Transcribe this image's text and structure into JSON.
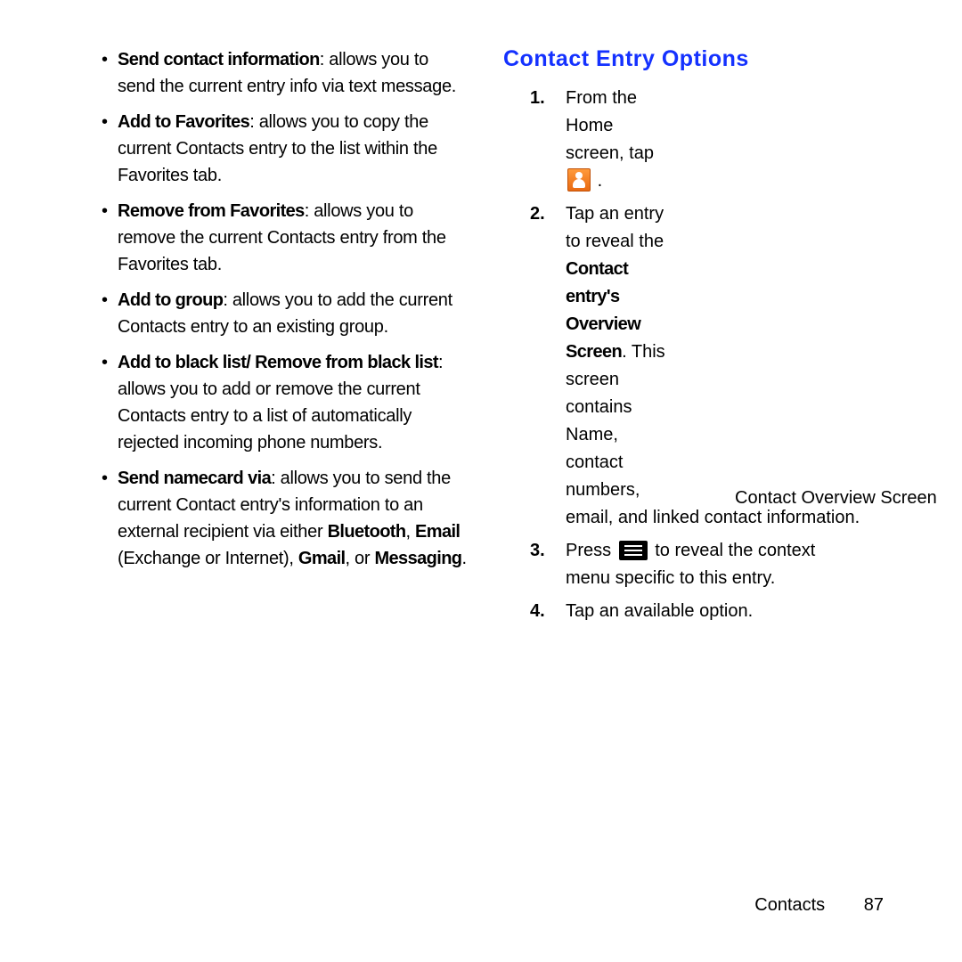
{
  "left": {
    "items": [
      {
        "term": "Send contact information",
        "rest": ": allows you to send the current entry info via text message."
      },
      {
        "term": "Add to Favorites",
        "rest": ": allows you to copy the current Contacts entry to the list within the Favorites tab."
      },
      {
        "term": "Remove from Favorites",
        "rest": ": allows you to remove the current Contacts entry from the Favorites tab."
      },
      {
        "term": "Add to group",
        "rest": ": allows you to add the current Contacts entry to an existing group."
      },
      {
        "term": "Add to black list/ Remove from black list",
        "rest": ": allows you to add or remove the current Contacts entry to a list of automatically rejected incoming phone numbers."
      }
    ],
    "namecard": {
      "term": "Send namecard via",
      "p1": ": allows you to send the current Contact entry's information to an external recipient via either ",
      "bt": "Bluetooth",
      "c1": ", ",
      "em": "Email",
      "p2": " (Exchange or Internet), ",
      "gm": "Gmail",
      "c2": ", or ",
      "msg": "Messaging",
      "dot": "."
    }
  },
  "right": {
    "heading": "Contact Entry Options",
    "step1": {
      "a": "From the Home screen, tap ",
      "b": "."
    },
    "step2": {
      "a": "Tap an entry to reveal the ",
      "bold": "Contact entry's Overview Screen",
      "b": ". This screen contains Name, contact numbers,",
      "c": " email, and linked contact information."
    },
    "caption": "Contact Overview Screen",
    "step3": {
      "a": "Press ",
      "b": " to reveal the context menu specific to this entry."
    },
    "step4": "Tap an available option."
  },
  "footer": {
    "section": "Contacts",
    "page": "87"
  }
}
